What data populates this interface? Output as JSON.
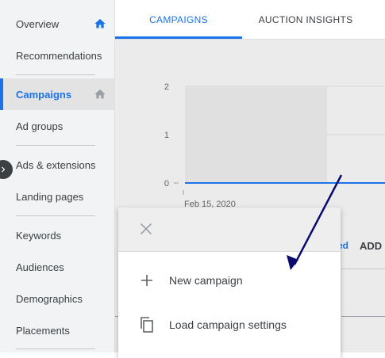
{
  "sidebar": {
    "items": [
      {
        "label": "Overview",
        "home": true
      },
      {
        "label": "Recommendations"
      },
      {
        "label": "Campaigns",
        "home": true,
        "active": true
      },
      {
        "label": "Ad groups"
      },
      {
        "label": "Ads & extensions"
      },
      {
        "label": "Landing pages"
      },
      {
        "label": "Keywords"
      },
      {
        "label": "Audiences"
      },
      {
        "label": "Demographics"
      },
      {
        "label": "Placements"
      }
    ]
  },
  "tabs": [
    {
      "label": "CAMPAIGNS",
      "active": true
    },
    {
      "label": "AUCTION INSIGHTS"
    }
  ],
  "chart_data": {
    "type": "line",
    "x": [
      "Feb 15, 2020"
    ],
    "y_ticks": [
      "2",
      "1",
      "0"
    ],
    "ylim": [
      0,
      2
    ],
    "series": [
      {
        "values": [
          0
        ]
      }
    ]
  },
  "behind": {
    "link_fragment": "ed",
    "add_label": "ADD"
  },
  "menu": {
    "close_icon": "close-icon",
    "items": [
      {
        "label": "New campaign",
        "icon": "plus-icon"
      },
      {
        "label": "Load campaign settings",
        "icon": "copy-icon"
      }
    ]
  },
  "colors": {
    "accent": "#1a73e8",
    "annotation_arrow": "#0a0a6e"
  }
}
